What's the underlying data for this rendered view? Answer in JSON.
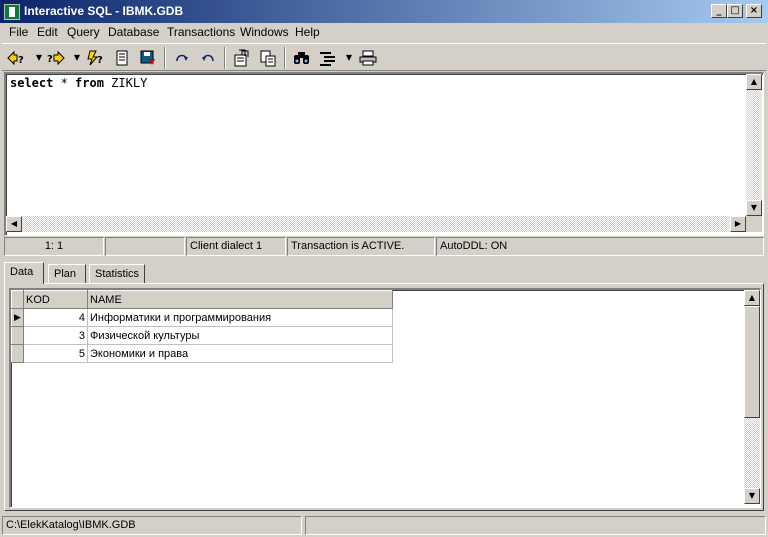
{
  "window": {
    "title": "Interactive SQL - IBMK.GDB",
    "min_label": "_",
    "max_label": "□",
    "close_label": "×"
  },
  "menu": [
    "File",
    "Edit",
    "Query",
    "Database",
    "Transactions",
    "Windows",
    "Help"
  ],
  "toolbar": {
    "icons": [
      "previous-query-icon",
      "next-query-icon",
      "execute-query-icon",
      "load-script-icon",
      "save-script-icon",
      "commit-icon",
      "rollback-icon",
      "copy-icon",
      "paste-icon",
      "find-icon",
      "indent-icon",
      "print-icon"
    ]
  },
  "editor": {
    "keyword1": "select",
    "star": " * ",
    "keyword2": "from",
    "table": " ZIKLY"
  },
  "status_mid": {
    "position": "1:  1",
    "empty": "",
    "dialect": "Client dialect 1",
    "transaction": "Transaction is ACTIVE.",
    "autoddl": "AutoDDL: ON"
  },
  "tabs": [
    "Data",
    "Plan",
    "Statistics"
  ],
  "grid": {
    "columns": [
      "KOD",
      "NAME"
    ],
    "rows": [
      {
        "kod": "4",
        "name": "Информатики и программирования"
      },
      {
        "kod": "3",
        "name": "Физической культуры"
      },
      {
        "kod": "5",
        "name": "Экономики и права"
      }
    ],
    "current_row_indicator": "▶"
  },
  "status_bottom": {
    "path": "C:\\ElekKatalog\\IBMK.GDB",
    "right": ""
  }
}
